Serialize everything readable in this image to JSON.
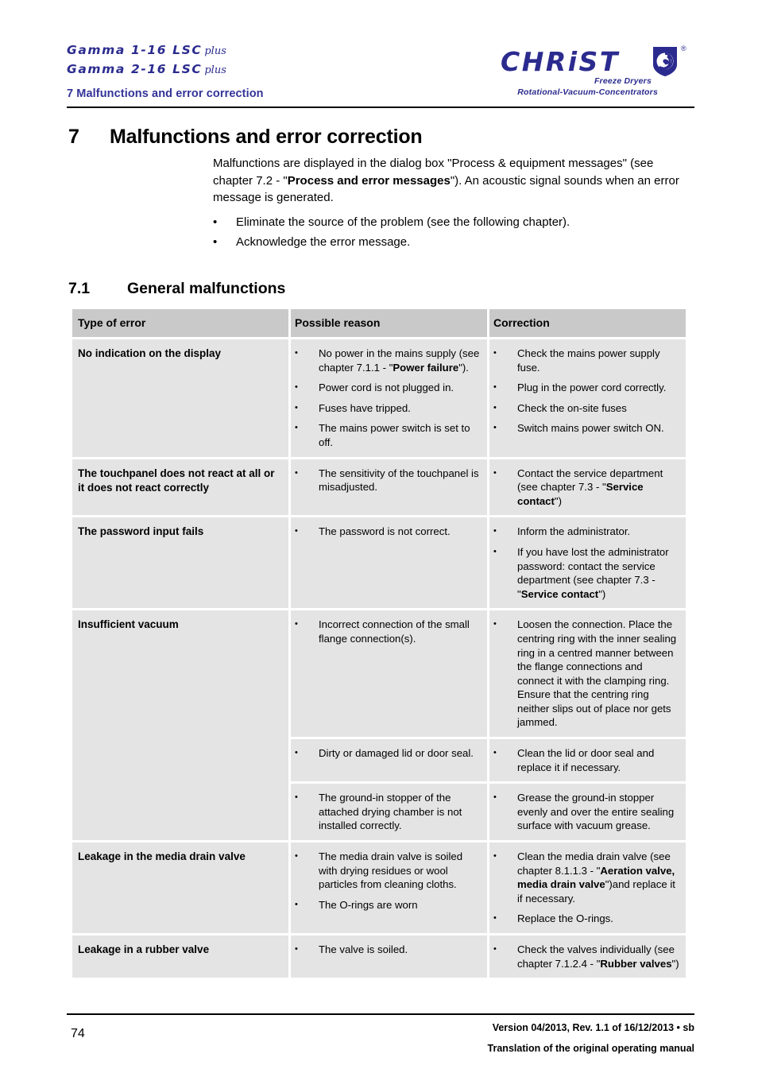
{
  "header": {
    "model_line_1": {
      "brand": "Gamma",
      "model": "1-16 LSC",
      "suffix": "plus"
    },
    "model_line_2": {
      "brand": "Gamma",
      "model": "2-16 LSC",
      "suffix": "plus"
    },
    "running_chapter": "7 Malfunctions and error correction",
    "logo": {
      "wordmark": "CHRiST",
      "registered_mark": "®",
      "tagline_1": "Freeze Dryers",
      "tagline_2": "Rotational-Vacuum-Concentrators",
      "brand_color": "#2b2b8f"
    },
    "chapter_color": "#333399"
  },
  "heading": {
    "h1_number": "7",
    "h1_title": "Malfunctions and error correction",
    "h2_number": "7.1",
    "h2_title": "General malfunctions"
  },
  "intro": {
    "paragraph_part_1": "Malfunctions are displayed in the dialog box \"Process & equipment messages\" (see chapter 7.2 - \"",
    "paragraph_bold": "Process and error messages",
    "paragraph_part_2": "\"). An acoustic signal sounds when an error message is generated.",
    "bullets": [
      "Eliminate the source of the problem (see the following chapter).",
      "Acknowledge the error message."
    ],
    "bullet_glyph": "•"
  },
  "table": {
    "columns": [
      "Type of error",
      "Possible reason",
      "Correction"
    ],
    "header_bg": "#c9c9c9",
    "cell_bg": "#e4e4e4",
    "bullet_glyph": "•",
    "rows": [
      {
        "error": "No indication on the display",
        "reasons": [
          {
            "pre": "No power in the mains supply (see chapter 7.1.1 - \"",
            "bold": "Power failure",
            "post": "\")."
          },
          {
            "pre": "Power cord is not plugged in.",
            "bold": "",
            "post": ""
          },
          {
            "pre": "Fuses have tripped.",
            "bold": "",
            "post": ""
          },
          {
            "pre": "The mains power switch is set to off.",
            "bold": "",
            "post": ""
          }
        ],
        "corrections": [
          {
            "pre": "Check the mains power supply fuse.",
            "bold": "",
            "post": ""
          },
          {
            "pre": "Plug in the power cord correctly.",
            "bold": "",
            "post": ""
          },
          {
            "pre": "Check the on-site fuses",
            "bold": "",
            "post": ""
          },
          {
            "pre": "Switch mains power switch ON.",
            "bold": "",
            "post": ""
          }
        ]
      },
      {
        "error": "The touchpanel does not react at all or it does not react correctly",
        "reasons": [
          {
            "pre": "The sensitivity of the touchpanel is misadjusted.",
            "bold": "",
            "post": ""
          }
        ],
        "corrections": [
          {
            "pre": "Contact the service department (see chapter 7.3 - \"",
            "bold": "Service contact",
            "post": "\")"
          }
        ]
      },
      {
        "error": "The password input fails",
        "reasons": [
          {
            "pre": "The password is not correct.",
            "bold": "",
            "post": ""
          }
        ],
        "corrections": [
          {
            "pre": "Inform the administrator.",
            "bold": "",
            "post": ""
          },
          {
            "pre": "If you have lost the administrator password: contact the service department (see chapter 7.3 - \"",
            "bold": "Service contact",
            "post": "\")"
          }
        ]
      },
      {
        "error": "Insufficient vacuum",
        "subrows": [
          {
            "reasons": [
              {
                "pre": "Incorrect connection of the small flange connection(s).",
                "bold": "",
                "post": ""
              }
            ],
            "corrections": [
              {
                "pre": "Loosen the connection. Place the centring ring with the inner sealing ring in a centred manner between the flange connections and connect it with the clamping ring. Ensure that the centring ring neither slips out of place nor gets jammed.",
                "bold": "",
                "post": ""
              }
            ]
          },
          {
            "reasons": [
              {
                "pre": "Dirty or damaged lid or door seal.",
                "bold": "",
                "post": ""
              }
            ],
            "corrections": [
              {
                "pre": "Clean the lid or door seal and replace it if necessary.",
                "bold": "",
                "post": ""
              }
            ]
          },
          {
            "reasons": [
              {
                "pre": "The ground-in stopper of the attached drying chamber is not installed correctly.",
                "bold": "",
                "post": ""
              }
            ],
            "corrections": [
              {
                "pre": "Grease the ground-in stopper evenly and over the entire sealing surface with vacuum grease.",
                "bold": "",
                "post": ""
              }
            ]
          }
        ]
      },
      {
        "error": "Leakage in the media drain valve",
        "reasons": [
          {
            "pre": "The media drain valve is soiled with drying residues or wool particles from cleaning cloths.",
            "bold": "",
            "post": ""
          },
          {
            "pre": "The O-rings are worn",
            "bold": "",
            "post": ""
          }
        ],
        "corrections": [
          {
            "pre": "Clean the media drain valve (see chapter 8.1.1.3 - \"",
            "bold": "Aeration valve, media drain valve",
            "post": "\")and replace it if necessary."
          },
          {
            "pre": "Replace the O-rings.",
            "bold": "",
            "post": ""
          }
        ]
      },
      {
        "error": "Leakage in a rubber valve",
        "reasons": [
          {
            "pre": "The valve is soiled.",
            "bold": "",
            "post": ""
          }
        ],
        "corrections": [
          {
            "pre": "Check the valves individually (see chapter 7.1.2.4 - \"",
            "bold": "Rubber valves",
            "post": "\")"
          }
        ]
      }
    ]
  },
  "footer": {
    "page_number": "74",
    "version_line": "Version 04/2013, Rev. 1.1 of 16/12/2013 • sb",
    "translation_line": "Translation of the original operating manual"
  }
}
